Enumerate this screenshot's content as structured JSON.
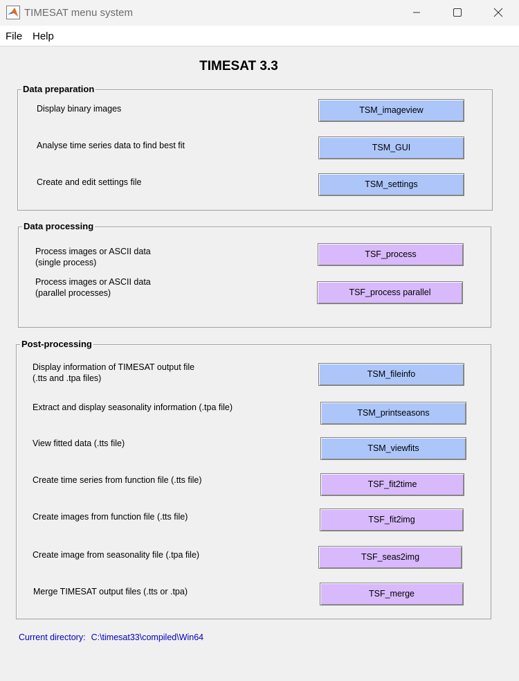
{
  "window": {
    "title": "TIMESAT menu system"
  },
  "menu": [
    {
      "label": "File"
    },
    {
      "label": "Help"
    }
  ],
  "app_title": "TIMESAT 3.3",
  "sections": {
    "data_preparation": {
      "title": "Data preparation",
      "items": [
        {
          "label": "Display binary images",
          "button": "TSM_imageview",
          "color": "#adc6fa"
        },
        {
          "label": "Analyse time series data to find best fit",
          "button": "TSM_GUI",
          "color": "#adc6fa"
        },
        {
          "label": "Create and edit settings file",
          "button": "TSM_settings",
          "color": "#adc6fa"
        }
      ]
    },
    "data_processing": {
      "title": "Data processing",
      "items": [
        {
          "label_line1": "Process images or ASCII data",
          "label_line2": "(single process)",
          "button": "TSF_process",
          "color": "#d8b9fb"
        },
        {
          "label_line1": "Process images or ASCII data",
          "label_line2": "(parallel processes)",
          "button": "TSF_process parallel",
          "color": "#d8b9fb"
        }
      ]
    },
    "post_processing": {
      "title": "Post-processing",
      "items": [
        {
          "label_line1": "Display information of TIMESAT output file",
          "label_line2": "(.tts and .tpa files)",
          "button": "TSM_fileinfo",
          "color": "#adc6fa"
        },
        {
          "label": "Extract and display seasonality information (.tpa file)",
          "button": "TSM_printseasons",
          "color": "#adc6fa"
        },
        {
          "label": "View fitted data (.tts file)",
          "button": "TSM_viewfits",
          "color": "#adc6fa"
        },
        {
          "label": "Create time series from function file (.tts file)",
          "button": "TSF_fit2time",
          "color": "#d8b9fb"
        },
        {
          "label": "Create images from function file (.tts file)",
          "button": "TSF_fit2img",
          "color": "#d8b9fb"
        },
        {
          "label": "Create image from seasonality file (.tpa file)",
          "button": "TSF_seas2img",
          "color": "#d8b9fb"
        },
        {
          "label": "Merge TIMESAT output files (.tts or .tpa)",
          "button": "TSF_merge",
          "color": "#d8b9fb"
        }
      ]
    }
  },
  "status": {
    "label": "Current directory:",
    "path": "C:\\timesat33\\compiled\\Win64"
  }
}
